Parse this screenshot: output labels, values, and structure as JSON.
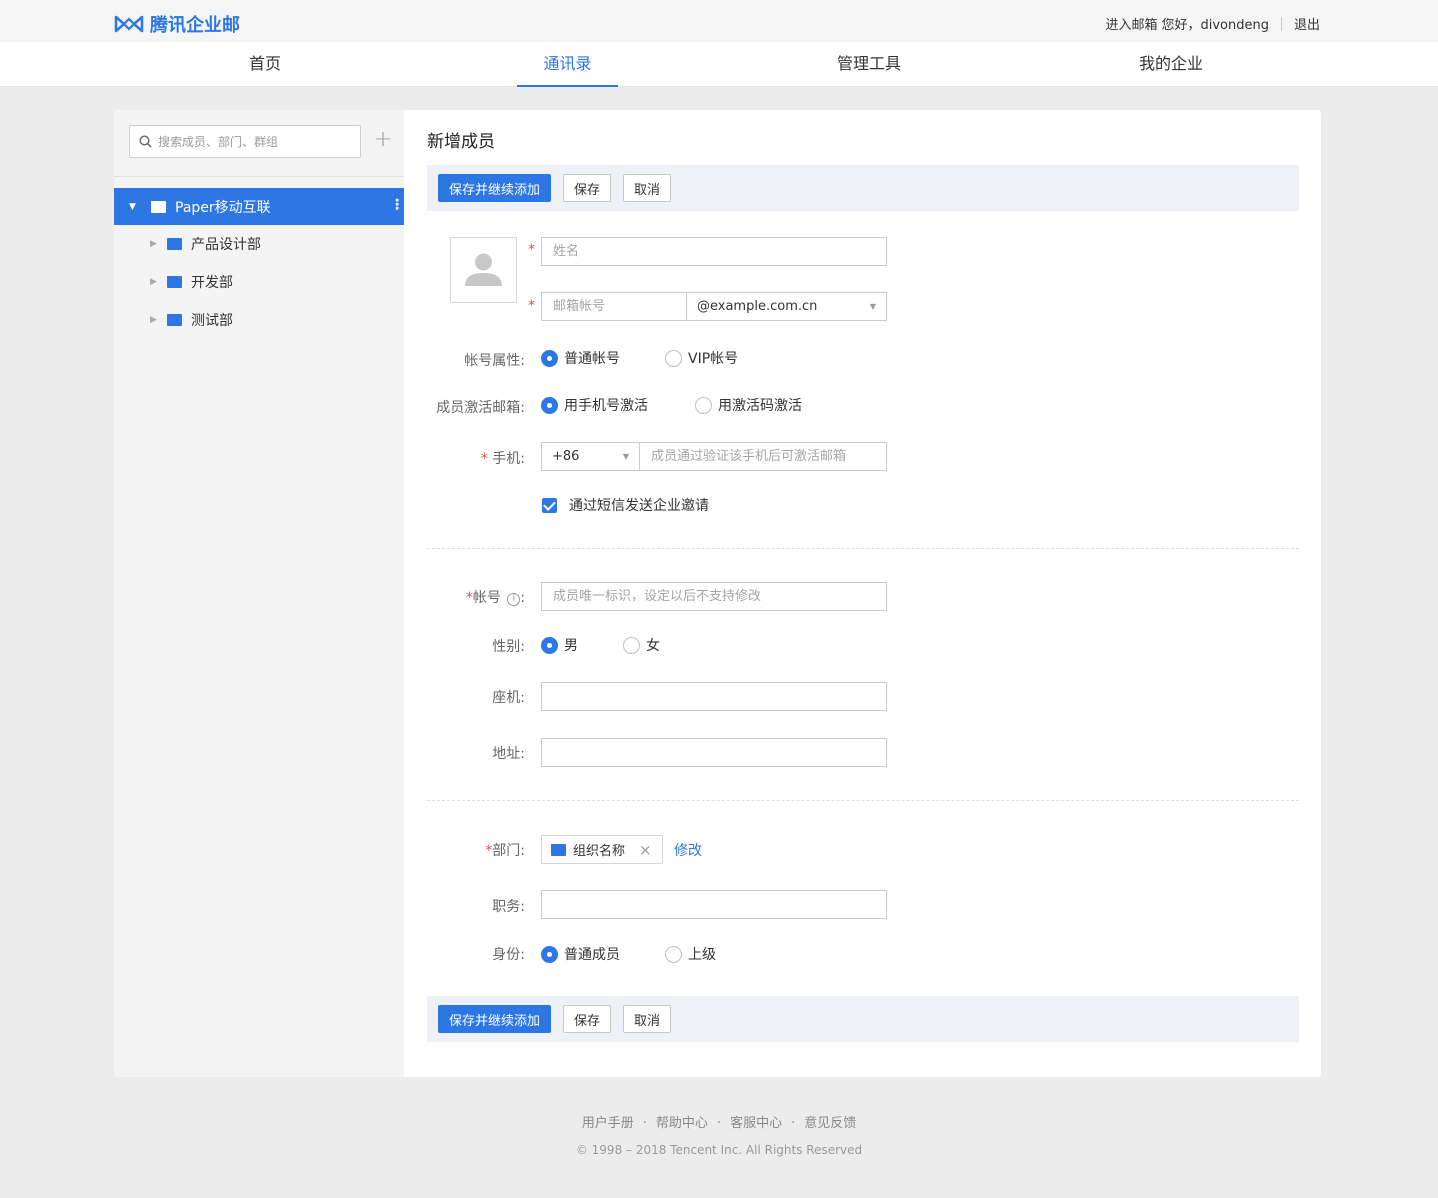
{
  "header": {
    "logo_text": "腾讯企业邮",
    "enter_mail": "进入邮箱",
    "greeting": "您好，divondeng",
    "logout": "退出"
  },
  "nav": {
    "items": [
      {
        "label": "首页"
      },
      {
        "label": "通讯录"
      },
      {
        "label": "管理工具"
      },
      {
        "label": "我的企业"
      }
    ],
    "active_index": 1
  },
  "sidebar": {
    "search_placeholder": "搜索成员、部门、群组",
    "add_symbol": "+",
    "root": {
      "label": "Paper移动互联"
    },
    "children": [
      {
        "label": "产品设计部"
      },
      {
        "label": "开发部"
      },
      {
        "label": "测试部"
      }
    ]
  },
  "form": {
    "title": "新增成员",
    "buttons": {
      "save_and_continue": "保存并继续添加",
      "save": "保存",
      "cancel": "取消"
    },
    "name_placeholder": "姓名",
    "email_placeholder": "邮箱帐号",
    "email_domain": "@example.com.cn",
    "account_type": {
      "label": "帐号属性:",
      "options": [
        "普通帐号",
        "VIP帐号"
      ],
      "selected": 0
    },
    "activation": {
      "label": "成员激活邮箱:",
      "options": [
        "用手机号激活",
        "用激活码激活"
      ],
      "selected": 0
    },
    "phone": {
      "required_mark": "*",
      "label": "手机:",
      "country_code": "+86",
      "placeholder": "成员通过验证该手机后可激活邮箱"
    },
    "sms_invite": {
      "label": "通过短信发送企业邀请",
      "checked": true
    },
    "account_id": {
      "label": "帐号",
      "info_icon": "i",
      "colon": ":",
      "placeholder": "成员唯一标识，设定以后不支持修改"
    },
    "gender": {
      "label": "性别:",
      "options": [
        "男",
        "女"
      ],
      "selected": 0
    },
    "landline": {
      "label": "座机:",
      "value": ""
    },
    "address": {
      "label": "地址:",
      "value": ""
    },
    "department": {
      "label": "部门:",
      "tag": "组织名称",
      "remove": "×",
      "edit_link": "修改"
    },
    "position": {
      "label": "职务:",
      "value": ""
    },
    "identity": {
      "label": "身份:",
      "options": [
        "普通成员",
        "上级"
      ],
      "selected": 0
    }
  },
  "footer": {
    "links": [
      "用户手册",
      "帮助中心",
      "客服中心",
      "意见反馈"
    ],
    "separator": "·",
    "copyright": "© 1998 – 2018 Tencent Inc. All Rights Reserved"
  },
  "colors": {
    "accent": "#2d77e4",
    "required": "#e34d4d",
    "page_bg": "#ececec"
  }
}
